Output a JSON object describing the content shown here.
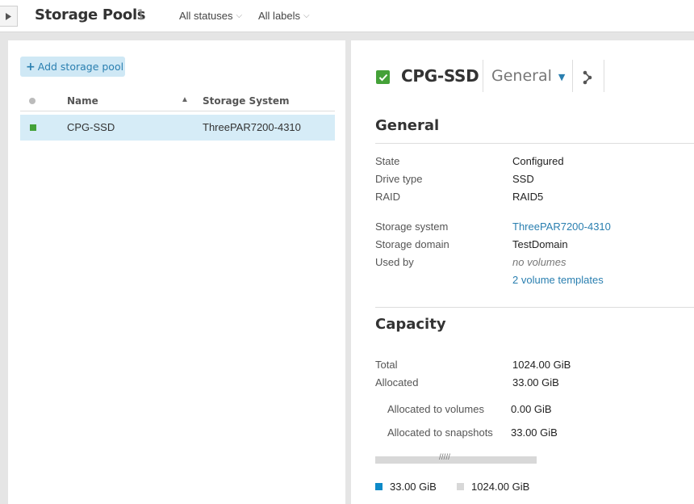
{
  "header": {
    "title": "Storage Pools",
    "count": "1",
    "filters": [
      {
        "label": "All statuses"
      },
      {
        "label": "All labels"
      }
    ]
  },
  "list": {
    "add_label": "Add storage pool",
    "columns": {
      "name": "Name",
      "system": "Storage System"
    },
    "rows": [
      {
        "name": "CPG-SSD",
        "system": "ThreePAR7200-4310",
        "status": "ok",
        "selected": true
      }
    ]
  },
  "detail": {
    "title": "CPG-SSD",
    "view": "General",
    "general": {
      "heading": "General",
      "fields": [
        {
          "label": "State",
          "value": "Configured"
        },
        {
          "label": "Drive type",
          "value": "SSD"
        },
        {
          "label": "RAID",
          "value": "RAID5"
        },
        {
          "label": "Storage system",
          "value": "ThreePAR7200-4310"
        },
        {
          "label": "Storage domain",
          "value": "TestDomain"
        },
        {
          "label": "Used by",
          "value": "no volumes"
        },
        {
          "label": "",
          "value": "2 volume templates"
        }
      ]
    },
    "capacity": {
      "heading": "Capacity",
      "fields": [
        {
          "label": "Total",
          "value": "1024.00 GiB"
        },
        {
          "label": "Allocated",
          "value": "33.00 GiB"
        },
        {
          "label": "Allocated to volumes",
          "value": "0.00 GiB"
        },
        {
          "label": "Allocated to snapshots",
          "value": "33.00 GiB"
        }
      ],
      "bar_hatch": "/////",
      "allocated_fraction": 0.0322,
      "legend": [
        {
          "label": "33.00 GiB",
          "color": "#0d8ac8"
        },
        {
          "label": "1024.00 GiB",
          "color": "#d8d8d8"
        }
      ]
    }
  },
  "colors": {
    "accent": "#2a7fb0",
    "status_ok": "#44a138",
    "selected_row": "#d6ecf7"
  }
}
